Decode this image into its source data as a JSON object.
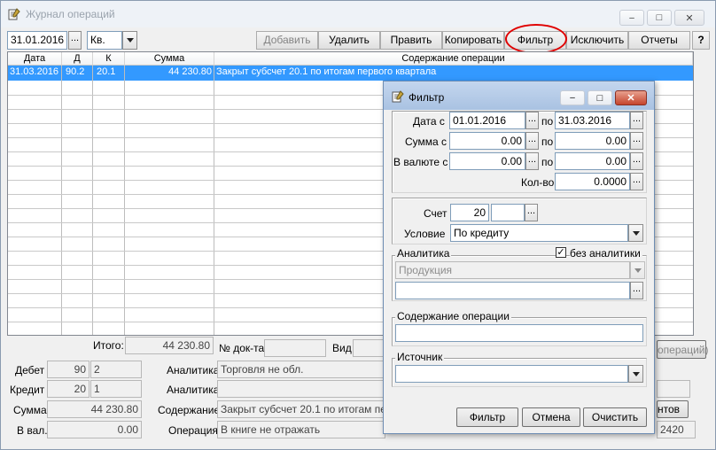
{
  "window": {
    "title": "Журнал операций",
    "min": "–",
    "max": "□",
    "close": "✕",
    "help": "?"
  },
  "toolbar": {
    "date": "31.01.2016",
    "period": "Кв.",
    "buttons": [
      "Добавить",
      "Удалить",
      "Править",
      "Копировать",
      "Фильтр",
      "Исключить",
      "Отчеты"
    ]
  },
  "grid": {
    "headers": [
      "Дата",
      "Д",
      "К",
      "Сумма",
      "Содержание операции"
    ],
    "rows": [
      {
        "date": "31.03.2016",
        "d": "90.2",
        "k": "20.1",
        "sum": "44 230.80",
        "desc": "Закрыт субсчет 20.1 по итогам первого квартала"
      }
    ]
  },
  "footer": {
    "total_label": "Итого:",
    "total": "44 230.80",
    "doc_label": "№ док-та",
    "doc": "",
    "vid_label": "Вид",
    "vid": "",
    "debet_label": "Дебет",
    "debet_acc": "90",
    "debet_sub": "2",
    "credit_label": "Кредит",
    "credit_acc": "20",
    "credit_sub": "1",
    "sum_label": "Сумма",
    "sum": "44 230.80",
    "val_label": "В вал.",
    "val": "0.00",
    "an1_label": "Аналитика",
    "an1": "Торговля не обл.",
    "an2_label": "Аналитика",
    "an2": "",
    "content_label": "Содержание",
    "content": "Закрыт субсчет 20.1 по итогам перв",
    "op_label": "Операция",
    "op": "В книге не отражать",
    "right_btn1": "операций)",
    "right_btn2": "нтов",
    "right_val": "2420"
  },
  "filter": {
    "title": "Фильтр",
    "date_label": "Дата с",
    "date_from": "01.01.2016",
    "po": "по",
    "date_to": "31.03.2016",
    "sum_label": "Сумма с",
    "sum_from": "0.00",
    "sum_to": "0.00",
    "cur_label": "В валюте с",
    "cur_from": "0.00",
    "cur_to": "0.00",
    "qty_label": "Кол-во",
    "qty": "0.0000",
    "acc_label": "Счет",
    "acc": "20",
    "acc_sub": "",
    "cond_label": "Условие",
    "cond": "По кредиту",
    "anal_label": "Аналитика",
    "noanal_label": "без аналитики",
    "noanal_check": "✓",
    "anal_value": "Продукция",
    "anal_value2": "",
    "content_label": "Содержание операции",
    "content": "",
    "source_label": "Источник",
    "source": "",
    "btn_filter": "Фильтр",
    "btn_cancel": "Отмена",
    "btn_clear": "Очистить"
  },
  "colors": {
    "accent": "#3399ff",
    "highlight": "#e00000"
  }
}
